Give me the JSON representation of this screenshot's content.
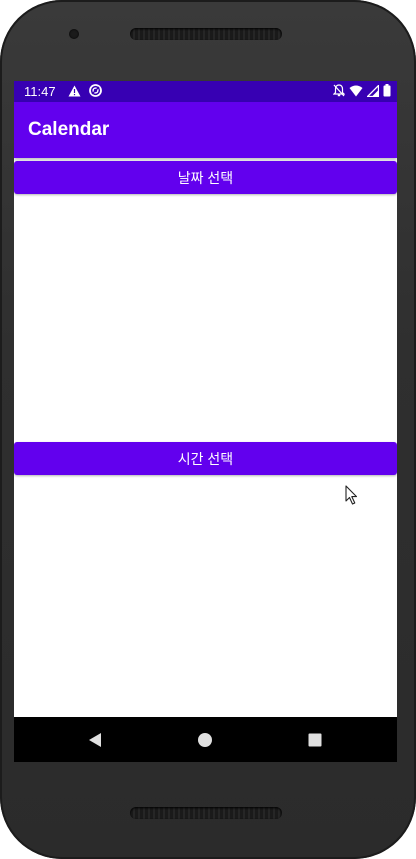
{
  "status_bar": {
    "time": "11:47",
    "left_icons": [
      "warning-icon",
      "sync-icon"
    ],
    "right_icons": [
      "notifications-off-icon",
      "wifi-icon",
      "signal-icon",
      "battery-icon"
    ],
    "color": "#3700b3"
  },
  "app_bar": {
    "title": "Calendar",
    "color": "#6200ee"
  },
  "buttons": {
    "date_label": "날짜 선택",
    "time_label": "시간 선택"
  },
  "nav_bar": {
    "items": [
      "back-icon",
      "home-icon",
      "recents-icon"
    ]
  }
}
